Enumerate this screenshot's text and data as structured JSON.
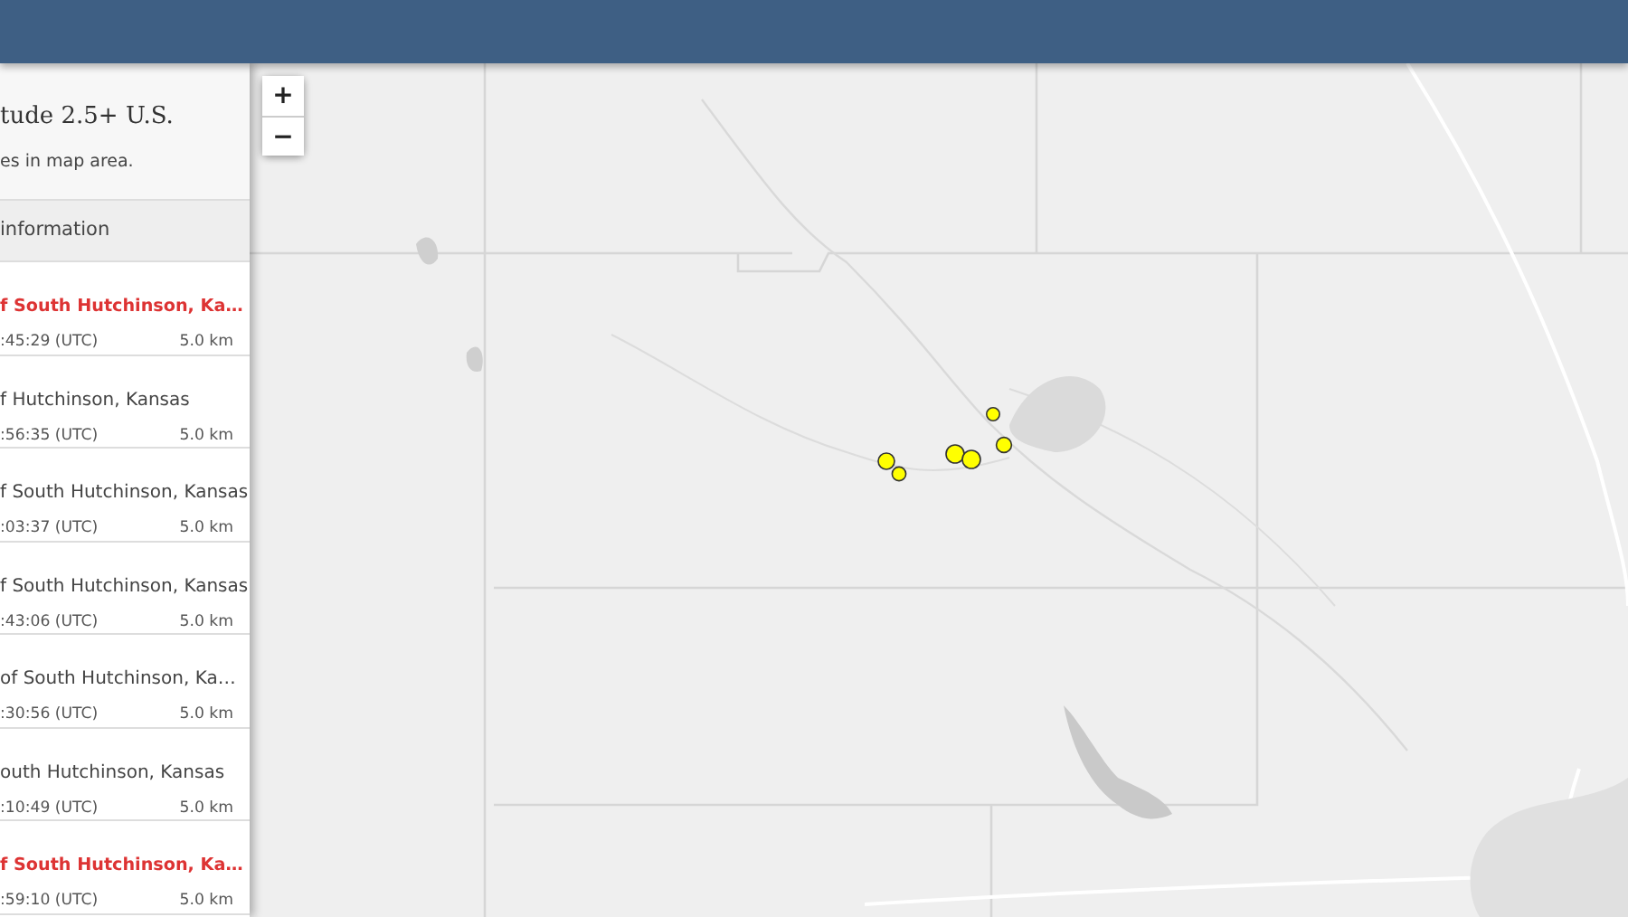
{
  "sidebar": {
    "title": "tude 2.5+ U.S.",
    "subtitle": "es in map area.",
    "section_header": "information",
    "items": [
      {
        "place": "f South Hutchinson, Ka…",
        "time": ":45:29 (UTC)",
        "depth": "5.0 km",
        "highlighted": true
      },
      {
        "place": "f Hutchinson, Kansas",
        "time": ":56:35 (UTC)",
        "depth": "5.0 km",
        "highlighted": false
      },
      {
        "place": "f South Hutchinson, Kansas",
        "time": ":03:37 (UTC)",
        "depth": "5.0 km",
        "highlighted": false
      },
      {
        "place": "f South Hutchinson, Kansas",
        "time": ":43:06 (UTC)",
        "depth": "5.0 km",
        "highlighted": false
      },
      {
        "place": "of South Hutchinson, Ka…",
        "time": ":30:56 (UTC)",
        "depth": "5.0 km",
        "highlighted": false
      },
      {
        "place": "outh Hutchinson, Kansas",
        "time": ":10:49 (UTC)",
        "depth": "5.0 km",
        "highlighted": false
      },
      {
        "place": "f South Hutchinson, Ka…",
        "time": ":59:10 (UTC)",
        "depth": "5.0 km",
        "highlighted": true
      }
    ]
  },
  "map": {
    "zoom_in": "+",
    "zoom_out": "−"
  }
}
